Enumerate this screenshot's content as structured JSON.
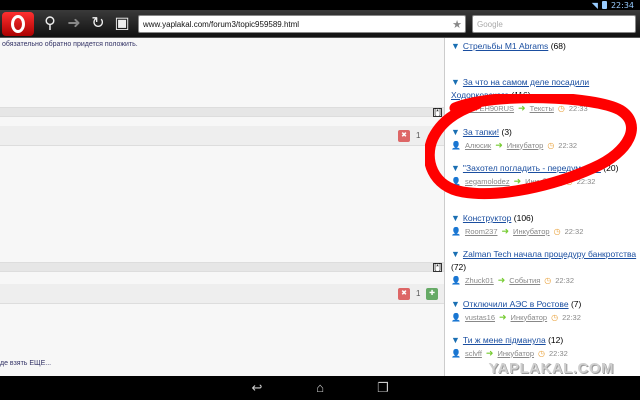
{
  "status": {
    "time": "22:34"
  },
  "toolbar": {
    "url": "www.yaplakal.com/forum3/topic959589.html",
    "search_placeholder": "Google"
  },
  "main": {
    "top_text": "обязательно обратно придется положить.",
    "vote1": "1",
    "vote2": "1",
    "bottom_link": "де взять ЕЩЕ...",
    "box_label": "[*]"
  },
  "sidebar": {
    "items": [
      {
        "title": "Стрельбы М1 Abrams",
        "count": "(68)"
      },
      {
        "title": "За что на самом деле посадили Ходорковского",
        "count": "(116)",
        "user": "ЯРГЕН90RUS",
        "section": "Тексты",
        "time": "22:33"
      },
      {
        "title": "За тапки!",
        "count": "(3)",
        "user": "Алюсик",
        "section": "Инкубатор",
        "time": "22:32"
      },
      {
        "title": "\"Захотел погладить - передумал...\"",
        "count": "(20)",
        "user": "segamolodez",
        "section": "Инкубатор",
        "time": "22:32"
      },
      {
        "title": "Конструктор",
        "count": "(106)",
        "user": "Room237",
        "section": "Инкубатор",
        "time": "22:32"
      },
      {
        "title": "Zalman Tech начала процедуру банкротства",
        "count": "(72)",
        "user": "Zhuck01",
        "section": "События",
        "time": "22:32"
      },
      {
        "title": "Отключили АЭС в Ростове",
        "count": "(7)",
        "user": "vustas16",
        "section": "Инкубатор",
        "time": "22:32"
      },
      {
        "title": "Ти ж мене підманула",
        "count": "(12)",
        "user": "sclvff",
        "section": "Инкубатор",
        "time": "22:32"
      }
    ]
  },
  "watermark": "YAPLAKAL.COM",
  "colors": {
    "link": "#1a4ea0",
    "scribble": "#ff0000",
    "opera": "#e01010"
  }
}
